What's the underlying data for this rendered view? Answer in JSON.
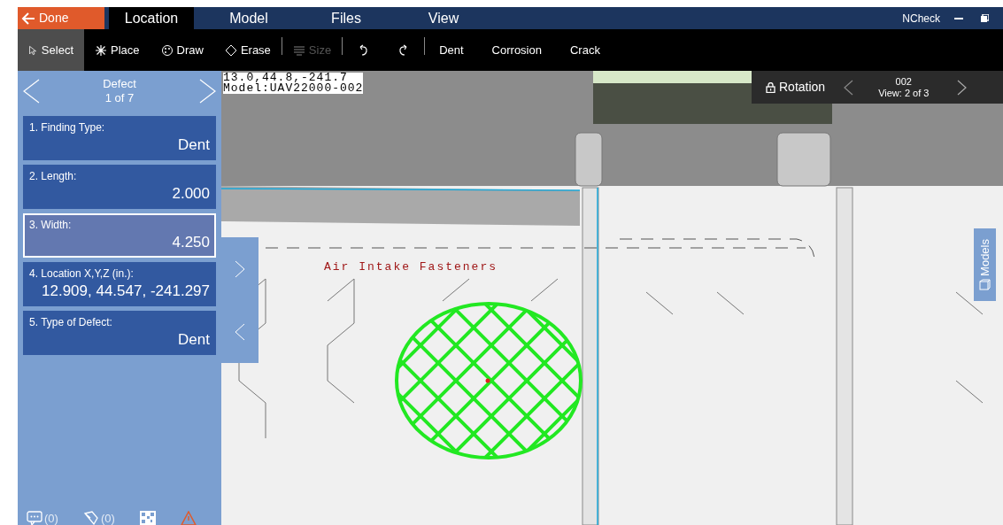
{
  "window": {
    "app_name": "NCheck"
  },
  "done_button": "Done",
  "tabs": [
    {
      "label": "Location",
      "selected": true
    },
    {
      "label": "Model",
      "selected": false
    },
    {
      "label": "Files",
      "selected": false
    },
    {
      "label": "View",
      "selected": false
    }
  ],
  "toolbar": [
    {
      "kind": "select",
      "label": "Select",
      "selected": true,
      "disabled": false
    },
    {
      "kind": "place",
      "label": "Place",
      "selected": false,
      "disabled": false
    },
    {
      "kind": "draw",
      "label": "Draw",
      "selected": false,
      "disabled": false
    },
    {
      "kind": "erase",
      "label": "Erase",
      "selected": false,
      "disabled": false
    },
    {
      "kind": "separator"
    },
    {
      "kind": "size",
      "label": "Size",
      "selected": false,
      "disabled": true
    },
    {
      "kind": "separator"
    },
    {
      "kind": "undo"
    },
    {
      "kind": "redo"
    },
    {
      "kind": "separator"
    },
    {
      "kind": "text",
      "label": "Dent",
      "selected": false,
      "disabled": false
    },
    {
      "kind": "text",
      "label": "Corrosion",
      "selected": false,
      "disabled": false
    },
    {
      "kind": "text",
      "label": "Crack",
      "selected": false,
      "disabled": false
    }
  ],
  "defect_panel": {
    "title": "Defect",
    "counter": "1 of 7",
    "fields": [
      {
        "label": "1. Finding Type:",
        "value": "Dent",
        "selected": false
      },
      {
        "label": "2. Length:",
        "value": "2.000",
        "selected": false
      },
      {
        "label": "3. Width:",
        "value": "4.250",
        "selected": true
      },
      {
        "label": "4. Location X,Y,Z (in.):",
        "value": "12.909, 44.547, -241.297",
        "selected": false
      },
      {
        "label": "5. Type of Defect:",
        "value": "Dent",
        "selected": false
      }
    ],
    "footer": [
      {
        "kind": "comments",
        "count": "(0)"
      },
      {
        "kind": "notes",
        "count": "(0)"
      },
      {
        "kind": "qr"
      },
      {
        "kind": "warning"
      }
    ]
  },
  "viewport": {
    "coordinates": "13.0,44.8,-241.7",
    "model": "Model:UAV22000-002",
    "annotation": "Air Intake Fasteners",
    "rotation": {
      "label": "Rotation",
      "view_id": "002",
      "view_counter": "View: 2 of 3"
    },
    "side_tab": "Models"
  }
}
